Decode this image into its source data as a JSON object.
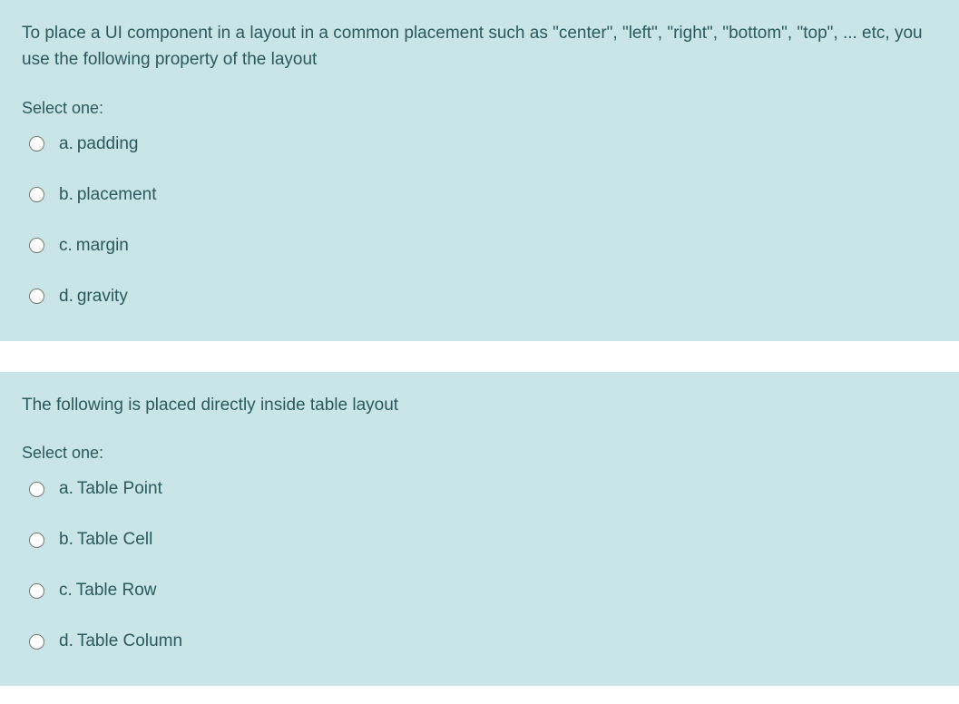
{
  "questions": [
    {
      "text": "To place a UI component in a layout in a common placement such as \"center\", \"left\", \"right\", \"bottom\", \"top\", ... etc, you use the following property of the layout",
      "prompt": "Select one:",
      "options": [
        {
          "letter": "a.",
          "label": "padding"
        },
        {
          "letter": "b.",
          "label": "placement"
        },
        {
          "letter": "c.",
          "label": "margin"
        },
        {
          "letter": "d.",
          "label": "gravity"
        }
      ]
    },
    {
      "text": "The following is placed directly inside table layout",
      "prompt": "Select one:",
      "options": [
        {
          "letter": "a.",
          "label": "Table Point"
        },
        {
          "letter": "b.",
          "label": "Table Cell"
        },
        {
          "letter": "c.",
          "label": "Table Row"
        },
        {
          "letter": "d.",
          "label": "Table Column"
        }
      ]
    }
  ]
}
